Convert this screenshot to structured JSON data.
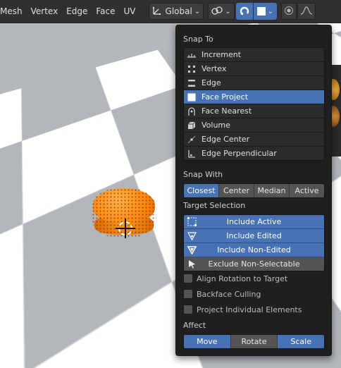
{
  "header": {
    "menu": [
      "Mesh",
      "Vertex",
      "Edge",
      "Face",
      "UV"
    ],
    "orientation_label": "Global",
    "icons": [
      "transform-orientation-icon",
      "pivot-link-icon",
      "snap-magnet-icon",
      "snap-target-square-icon",
      "proportional-edit-icon",
      "falloff-curve-icon"
    ]
  },
  "snap_panel": {
    "snap_to_title": "Snap To",
    "snap_to_items": [
      {
        "label": "Increment",
        "icon": "increment-icon",
        "selected": false
      },
      {
        "label": "Vertex",
        "icon": "vertex-icon",
        "selected": false
      },
      {
        "label": "Edge",
        "icon": "edge-icon",
        "selected": false
      },
      {
        "label": "Face Project",
        "icon": "face-project-icon",
        "selected": true
      },
      {
        "label": "Face Nearest",
        "icon": "face-nearest-icon",
        "selected": false
      },
      {
        "label": "Volume",
        "icon": "volume-icon",
        "selected": false
      },
      {
        "label": "Edge Center",
        "icon": "edge-center-icon",
        "selected": false
      },
      {
        "label": "Edge Perpendicular",
        "icon": "edge-perpendicular-icon",
        "selected": false
      }
    ],
    "snap_with_title": "Snap With",
    "snap_with_options": [
      "Closest",
      "Center",
      "Median",
      "Active"
    ],
    "snap_with_selected": "Closest",
    "target_selection_title": "Target Selection",
    "target_selection": [
      {
        "label": "Include Active",
        "icon": "include-active-icon",
        "on": true
      },
      {
        "label": "Include Edited",
        "icon": "include-edited-icon",
        "on": true
      },
      {
        "label": "Include Non-Edited",
        "icon": "include-non-edited-icon",
        "on": true
      },
      {
        "label": "Exclude Non-Selectable",
        "icon": "exclude-non-selectable-icon",
        "on": false
      }
    ],
    "checkboxes": [
      {
        "label": "Align Rotation to Target",
        "checked": false
      },
      {
        "label": "Backface Culling",
        "checked": false
      },
      {
        "label": "Project Individual Elements",
        "checked": false
      }
    ],
    "affect_title": "Affect",
    "affect_options": [
      "Move",
      "Rotate",
      "Scale"
    ],
    "affect_selected": [
      "Move",
      "Rotate",
      "Scale"
    ],
    "accent_color": "#4772b3"
  }
}
